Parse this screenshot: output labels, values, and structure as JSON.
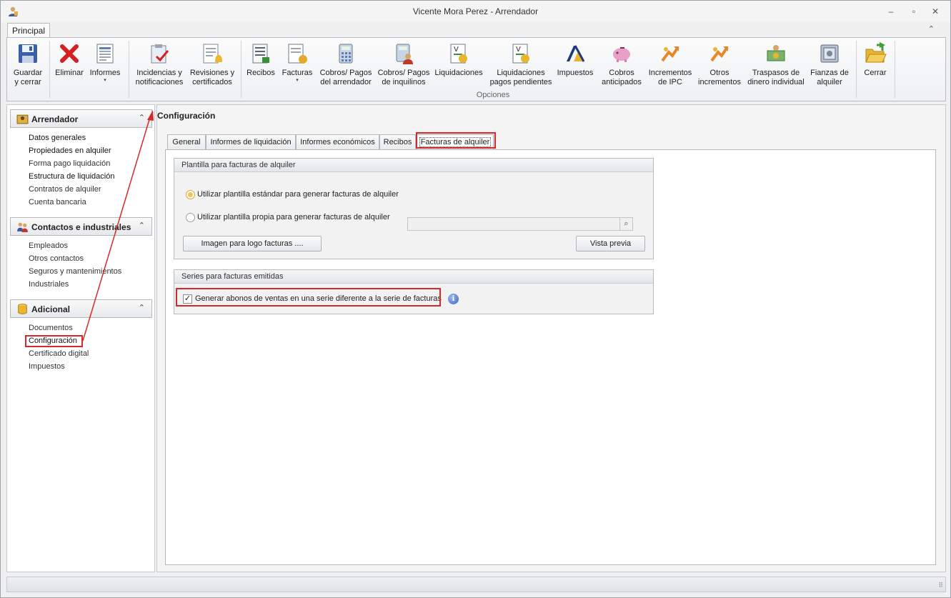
{
  "window": {
    "title": "Vicente Mora Perez - Arrendador",
    "minimize": "–",
    "restore": "▫",
    "close": "✕"
  },
  "ribbon": {
    "tab": "Principal",
    "collapse": "⌃",
    "group_label": "Opciones",
    "buttons": {
      "guardar": [
        "Guardar",
        "y cerrar"
      ],
      "eliminar": [
        "Eliminar"
      ],
      "informes": [
        "Informes"
      ],
      "incidencias": [
        "Incidencias y",
        "notificaciones"
      ],
      "revisiones": [
        "Revisiones y",
        "certificados"
      ],
      "recibos": [
        "Recibos"
      ],
      "facturas": [
        "Facturas"
      ],
      "cobros_arrendador": [
        "Cobros/ Pagos",
        "del arrendador"
      ],
      "cobros_inquilinos": [
        "Cobros/ Pagos",
        "de inquilinos"
      ],
      "liquidaciones": [
        "Liquidaciones"
      ],
      "liq_pendientes": [
        "Liquidaciones",
        "pagos pendientes"
      ],
      "impuestos": [
        "Impuestos"
      ],
      "cobros_anticipados": [
        "Cobros",
        "anticipados"
      ],
      "incrementos_ipc": [
        "Incrementos",
        "de IPC"
      ],
      "otros_incrementos": [
        "Otros",
        "incrementos"
      ],
      "traspasos": [
        "Traspasos de",
        "dinero individual"
      ],
      "fianzas": [
        "Fianzas de",
        "alquiler"
      ],
      "cerrar": [
        "Cerrar"
      ]
    },
    "dropdown_caret": "▾"
  },
  "sidebar": {
    "groups": [
      {
        "title": "Arrendador",
        "items": [
          "Datos generales",
          "Propiedades en alquiler",
          "Forma pago liquidación",
          "Estructura de liquidación",
          "Contratos de alquiler",
          "Cuenta bancaria"
        ]
      },
      {
        "title": "Contactos e industriales",
        "items": [
          "Empleados",
          "Otros contactos",
          "Seguros y mantenimientos",
          "Industriales"
        ]
      },
      {
        "title": "Adicional",
        "items": [
          "Documentos",
          "Configuración",
          "Certificado digital",
          "Impuestos"
        ]
      }
    ],
    "chevron": "⌃"
  },
  "content": {
    "title": "Configuración",
    "tabs": [
      "General",
      "Informes de liquidación",
      "Informes económicos",
      "Recibos",
      "Facturas de alquiler"
    ],
    "plantilla": {
      "title": "Plantilla para facturas de alquiler",
      "option_standard": "Utilizar plantilla estándar para generar facturas de alquiler",
      "option_custom": "Utilizar plantilla propia para generar facturas de alquiler",
      "custom_path_value": "",
      "logo_button": "Imagen para logo facturas ....",
      "preview_button": "Vista previa",
      "search_glyph": "⌕"
    },
    "series": {
      "title": "Series para facturas emitidas",
      "checkbox_label": "Generar abonos de ventas en una serie diferente a la serie de facturas",
      "checkbox_checked": true,
      "check_glyph": "✓",
      "info_glyph": "i"
    }
  },
  "statusbar": {
    "grip": "⠿"
  },
  "colors": {
    "highlight": "#d42a2a",
    "radio_selected": "#f3c255",
    "info": "#3b64c4"
  }
}
